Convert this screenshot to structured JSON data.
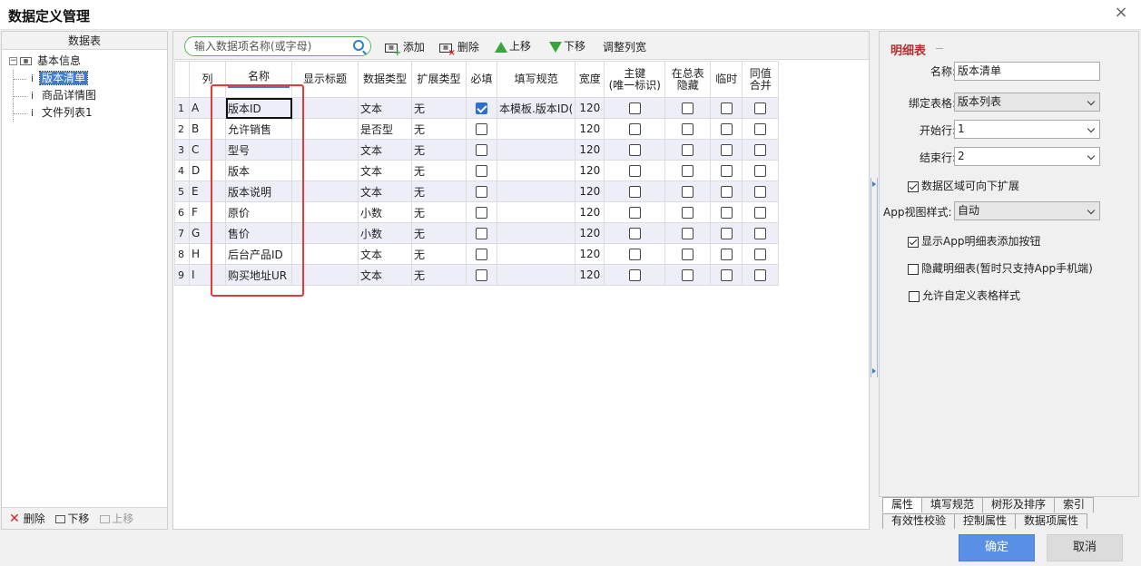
{
  "window": {
    "title": "数据定义管理",
    "close_glyph": "×"
  },
  "left_panel": {
    "header": "数据表",
    "tree": {
      "root_label": "基本信息",
      "children": [
        {
          "label": "版本清单",
          "selected": true
        },
        {
          "label": "商品详情图",
          "selected": false
        },
        {
          "label": "文件列表1",
          "selected": false
        }
      ]
    },
    "footer": {
      "delete": "删除",
      "move_down": "下移",
      "move_up": "上移"
    }
  },
  "toolbar": {
    "search_placeholder": "输入数据项名称(或字母)",
    "add": "添加",
    "delete": "删除",
    "move_up": "上移",
    "move_down": "下移",
    "adjust_width": "调整列宽"
  },
  "grid": {
    "headers": {
      "col": "列",
      "name": "名称",
      "display_title": "显示标题",
      "data_type": "数据类型",
      "ext_type": "扩展类型",
      "required": "必填",
      "fill_rule": "填写规范",
      "width": "宽度",
      "pk_line1": "主键",
      "pk_line2": "(唯一标识)",
      "hidden_line1": "在总表",
      "hidden_line2": "隐藏",
      "temp": "临时",
      "merge_line1": "同值",
      "merge_line2": "合并"
    },
    "rows": [
      {
        "n": "1",
        "col": "A",
        "name": "版本ID",
        "title": "",
        "type": "文本",
        "ext": "无",
        "required": true,
        "rule": "本模板.版本ID(",
        "width": "120"
      },
      {
        "n": "2",
        "col": "B",
        "name": "允许销售",
        "title": "",
        "type": "是否型",
        "ext": "无",
        "required": false,
        "rule": "",
        "width": "120"
      },
      {
        "n": "3",
        "col": "C",
        "name": "型号",
        "title": "",
        "type": "文本",
        "ext": "无",
        "required": false,
        "rule": "",
        "width": "120"
      },
      {
        "n": "4",
        "col": "D",
        "name": "版本",
        "title": "",
        "type": "文本",
        "ext": "无",
        "required": false,
        "rule": "",
        "width": "120"
      },
      {
        "n": "5",
        "col": "E",
        "name": "版本说明",
        "title": "",
        "type": "文本",
        "ext": "无",
        "required": false,
        "rule": "",
        "width": "120"
      },
      {
        "n": "6",
        "col": "F",
        "name": "原价",
        "title": "",
        "type": "小数",
        "ext": "无",
        "required": false,
        "rule": "",
        "width": "120"
      },
      {
        "n": "7",
        "col": "G",
        "name": "售价",
        "title": "",
        "type": "小数",
        "ext": "无",
        "required": false,
        "rule": "",
        "width": "120"
      },
      {
        "n": "8",
        "col": "H",
        "name": "后台产品ID",
        "title": "",
        "type": "文本",
        "ext": "无",
        "required": false,
        "rule": "",
        "width": "120"
      },
      {
        "n": "9",
        "col": "I",
        "name": "购买地址UR",
        "title": "",
        "type": "文本",
        "ext": "无",
        "required": false,
        "rule": "",
        "width": "120"
      }
    ]
  },
  "right_panel": {
    "section_title": "明细表",
    "name_label": "名称:",
    "name_value": "版本清单",
    "bind_label": "绑定表格:",
    "bind_value": "版本列表",
    "start_label": "开始行:",
    "start_value": "1",
    "end_label": "结束行:",
    "end_value": "2",
    "expand_down": "数据区域可向下扩展",
    "expand_down_checked": true,
    "app_style_label": "App视图样式:",
    "app_style_value": "自动",
    "show_add_btn": "显示App明细表添加按钮",
    "show_add_btn_checked": true,
    "hide_detail": "隐藏明细表(暂时只支持App手机端)",
    "hide_detail_checked": false,
    "custom_style": "允许自定义表格样式",
    "custom_style_checked": false,
    "tabs_row1": [
      "属性",
      "填写规范",
      "树形及排序",
      "索引"
    ],
    "tabs_row2": [
      "有效性校验",
      "控制属性",
      "数据项属性"
    ]
  },
  "buttons": {
    "ok": "确定",
    "cancel": "取消"
  },
  "colors": {
    "accent": "#5a8fe6",
    "highlight": "#e23b3b",
    "selection": "#3a7bd5",
    "row_alt": "#eeeef9"
  }
}
